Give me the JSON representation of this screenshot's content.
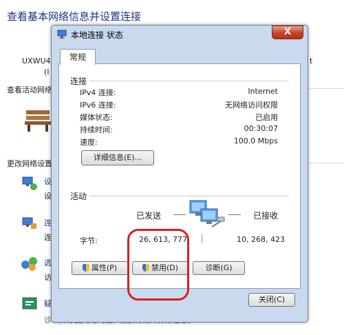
{
  "background": {
    "title": "查看基本网络信息并设置连接",
    "left_text_1": "UXWU4",
    "left_text_2": "(I",
    "right_text": "t",
    "section_active": "查看活动网络",
    "section_change": "更改网络设置",
    "change_items": [
      {
        "line1": "设",
        "line2": "设"
      },
      {
        "line1": "连",
        "line2": "连"
      },
      {
        "line1": "选",
        "line2": "访"
      },
      {
        "line1": "疑",
        "line2": ""
      }
    ],
    "bottom_text": "诊断并修复网络问题，或获得故障排除信息。"
  },
  "dialog": {
    "title": "本地连接 状态",
    "close_glyph": "X",
    "tab": "常规",
    "connection": {
      "heading": "连接",
      "rows": [
        {
          "label": "IPv4 连接:",
          "value": "Internet"
        },
        {
          "label": "IPv6 连接:",
          "value": "无网络访问权限"
        },
        {
          "label": "媒体状态:",
          "value": "已启用"
        },
        {
          "label": "持续时间:",
          "value": "00:30:07"
        },
        {
          "label": "速度:",
          "value": "100.0 Mbps"
        }
      ],
      "details_button": "详细信息(E)..."
    },
    "activity": {
      "heading": "活动",
      "sent_label": "已发送",
      "received_label": "已接收",
      "bytes_label": "字节:",
      "bytes_sent": "26, 613, 777",
      "bytes_received": "10, 268, 423"
    },
    "buttons": {
      "properties": "属性(P)",
      "disable": "禁用(D)",
      "diagnose": "诊断(G)",
      "close": "关闭(C)"
    }
  }
}
